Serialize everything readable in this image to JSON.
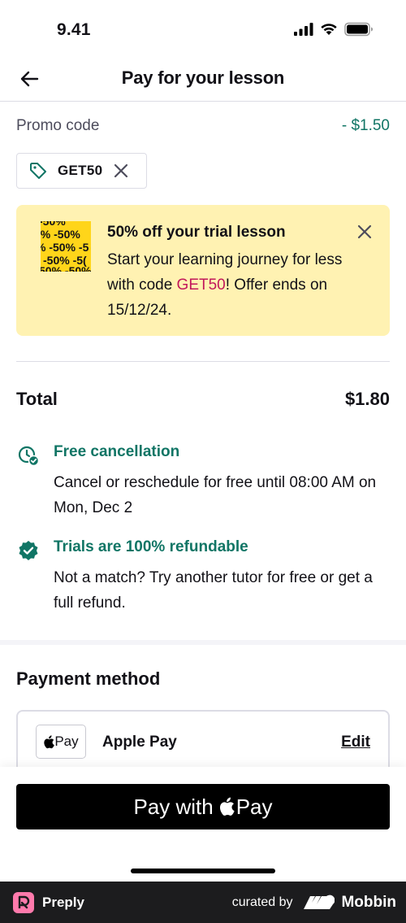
{
  "status_bar": {
    "time": "9.41"
  },
  "nav": {
    "title": "Pay for your lesson",
    "back_icon": "arrow-left-icon"
  },
  "promo": {
    "label": "Promo code",
    "discount": "- $1.50",
    "chip_code": "GET50",
    "chip_icon": "tag-icon"
  },
  "banner": {
    "image_text": "-50%",
    "title": "50% off your trial lesson",
    "body_before": "Start your learning journey for less with code ",
    "code": "GET50",
    "body_after": "! Offer ends on 15/12/24."
  },
  "total": {
    "label": "Total",
    "value": "$1.80"
  },
  "features": [
    {
      "icon": "clock-check-icon",
      "title": "Free cancellation",
      "description": "Cancel or reschedule for free until 08:00 AM on Mon, Dec 2"
    },
    {
      "icon": "verified-badge-icon",
      "title": "Trials are 100% refundable",
      "description": "Not a match? Try another tutor for free or get a full refund."
    }
  ],
  "payment": {
    "heading": "Payment method",
    "badge_text": "Pay",
    "method_name": "Apple Pay",
    "edit_label": "Edit"
  },
  "pay_button": {
    "prefix": "Pay with",
    "suffix": "Pay"
  },
  "footer": {
    "app_name": "Preply",
    "curated_by": "curated by",
    "brand": "Mobbin"
  },
  "colors": {
    "accent_green": "#107565",
    "banner_bg": "#fff2b2",
    "promo_code_pink": "#c2185b",
    "pay_button_bg": "#000000"
  }
}
